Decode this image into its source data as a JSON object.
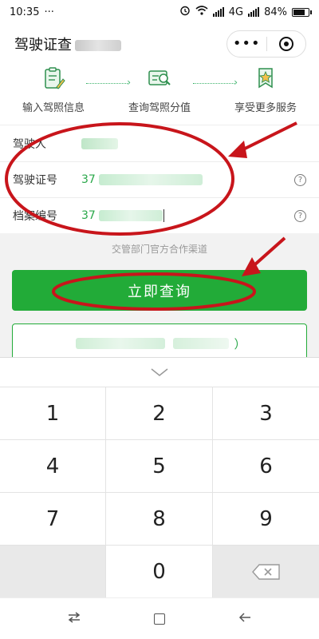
{
  "status": {
    "time": "10:35",
    "dots": "···",
    "network": "4G",
    "battery": "84%"
  },
  "header": {
    "title": "驾驶证查",
    "more_glyph": "•••"
  },
  "steps": [
    {
      "label": "输入驾照信息"
    },
    {
      "label": "查询驾照分值"
    },
    {
      "label": "享受更多服务"
    }
  ],
  "form": {
    "driver_name_label": "驾驶人",
    "license_number_label": "驾驶证号",
    "license_number_value": "37",
    "file_number_label": "档案编号",
    "file_number_value": "37",
    "help_glyph": "?"
  },
  "partner_text": "交管部门官方合作渠道",
  "query_button_label": "立即查询",
  "link_box_tail": "）",
  "keyboard": {
    "keys": [
      "1",
      "2",
      "3",
      "4",
      "5",
      "6",
      "7",
      "8",
      "9",
      "",
      "0",
      ""
    ]
  },
  "colors": {
    "accent": "#22ab38",
    "annotation": "#c8151b"
  }
}
